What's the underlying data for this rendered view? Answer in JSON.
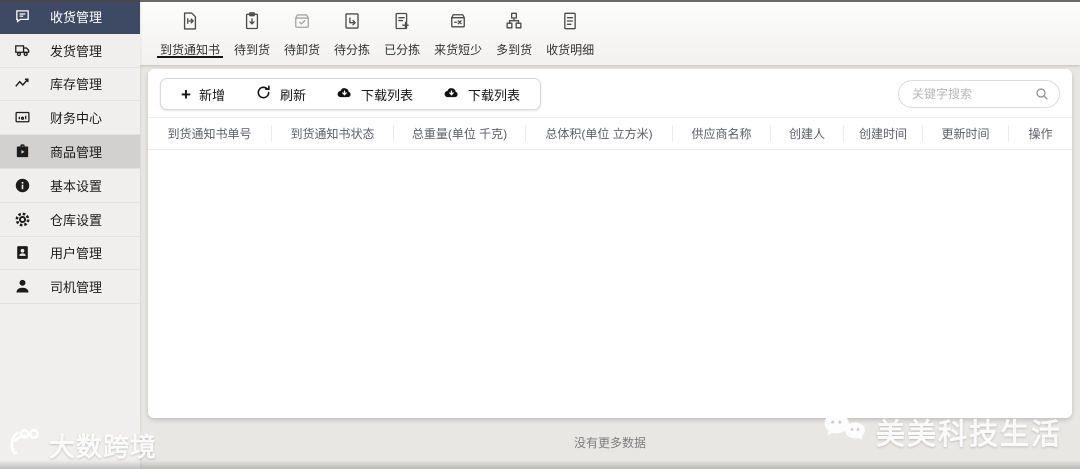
{
  "sidebar": {
    "items": [
      {
        "label": "收货管理",
        "icon": "message-icon",
        "state": "active"
      },
      {
        "label": "发货管理",
        "icon": "truck-icon",
        "state": "normal"
      },
      {
        "label": "库存管理",
        "icon": "trend-line-icon",
        "state": "normal"
      },
      {
        "label": "财务中心",
        "icon": "finance-chart-icon",
        "state": "normal"
      },
      {
        "label": "商品管理",
        "icon": "briefcase-icon",
        "state": "highlighted"
      },
      {
        "label": "基本设置",
        "icon": "info-icon",
        "state": "normal"
      },
      {
        "label": "仓库设置",
        "icon": "gear-icon",
        "state": "normal"
      },
      {
        "label": "用户管理",
        "icon": "id-badge-icon",
        "state": "normal"
      },
      {
        "label": "司机管理",
        "icon": "person-icon",
        "state": "normal"
      }
    ]
  },
  "tabs": [
    {
      "label": "到货通知书",
      "icon": "document-arrow-icon",
      "active": true
    },
    {
      "label": "待到货",
      "icon": "clipboard-down-icon",
      "active": false
    },
    {
      "label": "待卸货",
      "icon": "box-check-icon",
      "active": false
    },
    {
      "label": "待分拣",
      "icon": "box-return-arrow-icon",
      "active": false
    },
    {
      "label": "已分拣",
      "icon": "document-plus-icon",
      "active": false
    },
    {
      "label": "来货短少",
      "icon": "box-x-icon",
      "active": false
    },
    {
      "label": "多到货",
      "icon": "blocks-icon",
      "active": false
    },
    {
      "label": "收货明细",
      "icon": "document-list-icon",
      "active": false
    }
  ],
  "toolbar": {
    "add_label": "新增",
    "refresh_label": "刷新",
    "download_list_label": "下载列表",
    "download_list2_label": "下载列表"
  },
  "search": {
    "placeholder": "关键字搜索",
    "value": ""
  },
  "table": {
    "columns": [
      "到货通知书单号",
      "到货通知书状态",
      "总重量(单位 千克)",
      "总体积(单位 立方米)",
      "供应商名称",
      "创建人",
      "创建时间",
      "更新时间",
      "操作"
    ],
    "rows": [],
    "empty_text": "没有更多数据"
  },
  "watermarks": {
    "bottom_left": "大数跨境",
    "bottom_right": "美美科技生活"
  },
  "colors": {
    "sidebar_active_bg": "#3e4a63",
    "sidebar_highlight_bg": "#d2d1d0",
    "sidebar_bg": "#f0efed",
    "backdrop": "#e9e7e4",
    "card_bg": "#ffffff",
    "tab_underline": "#151515",
    "header_text": "#5c5f66"
  }
}
